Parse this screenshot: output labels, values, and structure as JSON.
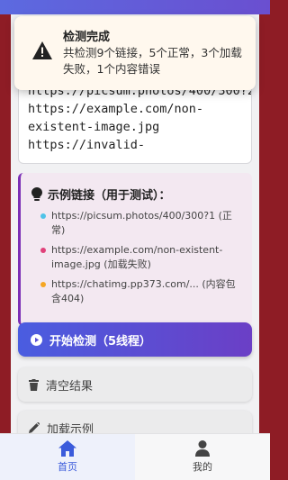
{
  "toast": {
    "title": "检测完成",
    "message": "共检测9个链接，5个正常，3个加载失败，1个内容错误",
    "icon": "warning-icon"
  },
  "url_input": {
    "lines": [
      "https://picsum.photos/400/300?2",
      "https://example.com/non-",
      "existent-image.jpg",
      "https://invalid-"
    ]
  },
  "examples": {
    "icon": "lightbulb-icon",
    "title": "示例链接（用于测试）：",
    "items": [
      {
        "text": "https://picsum.photos/400/300?1 (正常)",
        "color": "#4fc3e8"
      },
      {
        "text": "https://example.com/non-existent-image.jpg (加载失败)",
        "color": "#e0417a"
      },
      {
        "text": "https://chatimg.pp373.com/... (内容包含404)",
        "color": "#f5a623"
      }
    ]
  },
  "actions": {
    "start_label": "开始检测（5线程）",
    "clear_label": "清空结果",
    "load_label": "加载示例"
  },
  "nav": {
    "home_label": "首页",
    "profile_label": "我的",
    "active_color": "#3b5bdb"
  }
}
